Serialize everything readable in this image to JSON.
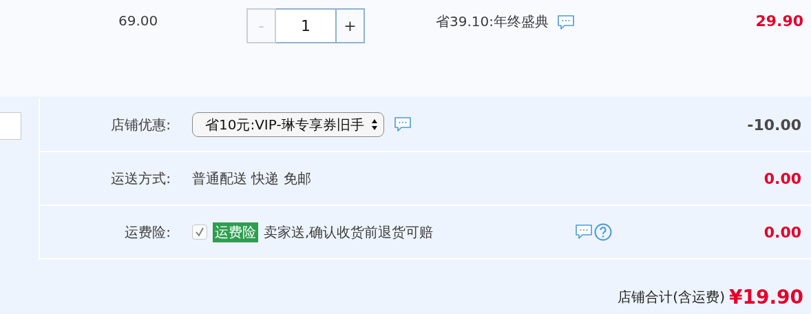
{
  "item": {
    "unit_price": "69.00",
    "quantity": {
      "decrement": "-",
      "decrement_disabled": true,
      "value": "1",
      "increment": "+"
    },
    "promotion": "省39.10:年终盛典",
    "subtotal": "29.90"
  },
  "shop_rows": [
    {
      "kind": "select",
      "label": "店铺优惠:",
      "value": "省10元:VIP-琳专享券旧手",
      "note_icon": true,
      "help_icon": false,
      "amount": "-10.00",
      "color": "#4a4a4a"
    },
    {
      "kind": "text",
      "label": "运送方式:",
      "value": "普通配送 快递 免邮",
      "note_icon": false,
      "help_icon": false,
      "amount": "0.00",
      "color": "#e4002b"
    },
    {
      "kind": "checkbox",
      "label": "运费险:",
      "checked": true,
      "tag": "运费险",
      "value": "卖家送,确认收货前退货可赔",
      "note_icon": true,
      "help_icon": true,
      "amount": "0.00",
      "color": "#e4002b"
    }
  ],
  "total": {
    "label": "店铺合计(含运费)",
    "amount": "¥19.90"
  }
}
